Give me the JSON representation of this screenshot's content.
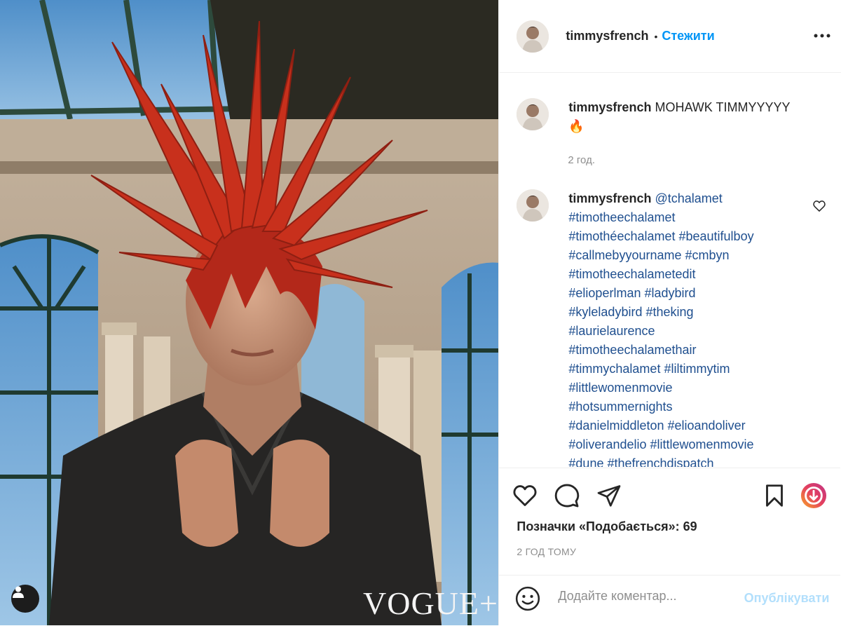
{
  "post": {
    "username": "timmysfrench",
    "follow_label": "Стежити",
    "dot": "•",
    "watermark": "VOGUE+",
    "caption": {
      "username": "timmysfrench",
      "text": "MOHAWK TIMMYYYYY",
      "emoji": "🔥",
      "time": "2 год."
    },
    "comment": {
      "username": "timmysfrench",
      "mention": "@tchalamet",
      "lines": [
        "#timotheechalamet",
        "#timothéechalamet #beautifulboy",
        "#callmebyyourname #cmbyn",
        "#timotheechalametedit",
        "#elioperlman #ladybird",
        "#kyleladybird #theking",
        "#laurielaurence",
        "#timotheechalamethair",
        "#timmychalamet #liltimmytim",
        "#littlewomenmovie",
        "#hotsummernights",
        "#danielmiddleton #elioandoliver",
        "#oliverandelio #littlewomenmovie",
        "#dune #thefrenchdispatch"
      ]
    },
    "likes_text": "Позначки «Подобається»: 69",
    "posted_ago": "2 ГОД ТОМУ",
    "add_comment_placeholder": "Додайте коментар...",
    "publish_label": "Опублікувати"
  },
  "icons": {
    "more": "more-options-icon",
    "like": "heart-icon",
    "comment": "comment-bubble-icon",
    "share": "paper-plane-icon",
    "save": "bookmark-icon",
    "tags": "user-tag-icon",
    "emoji": "smiley-icon"
  },
  "colors": {
    "link": "#0095f6",
    "hashtag": "#1f4f8f",
    "muted": "#8e8e8e",
    "publish_disabled": "#b2dffc",
    "hair": "#c8301c"
  }
}
